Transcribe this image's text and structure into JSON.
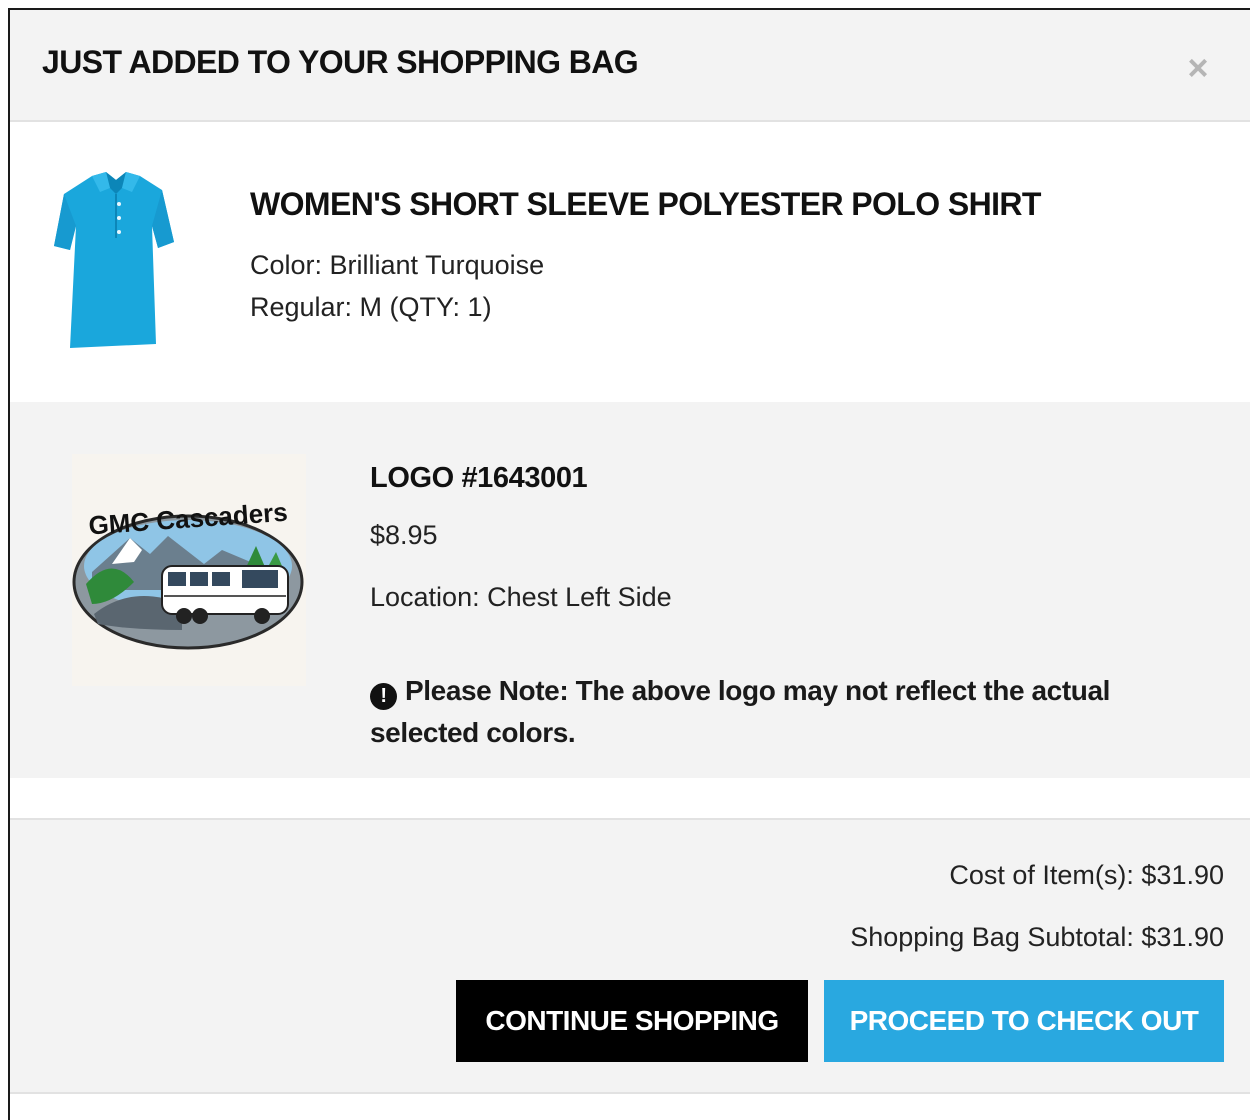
{
  "modal": {
    "title": "JUST ADDED TO YOUR SHOPPING BAG",
    "close_label": "×"
  },
  "product": {
    "image_icon": "polo-shirt-image",
    "image_color": "#1aa7dc",
    "name": "WOMEN'S SHORT SLEEVE POLYESTER POLO SHIRT",
    "color": "Color: Brilliant Turquoise",
    "size_qty": "Regular: M (QTY: 1)"
  },
  "logo": {
    "image_text": "GMC Cascaders",
    "title": "LOGO #1643001",
    "price": "$8.95",
    "location": "Location: Chest Left Side",
    "note_icon": "exclamation-circle-icon",
    "note_text": "Please Note: The above logo may not reflect the actual selected colors."
  },
  "summary": {
    "cost": "Cost of Item(s): $31.90",
    "subtotal": "Shopping Bag Subtotal: $31.90"
  },
  "buttons": {
    "continue": "CONTINUE SHOPPING",
    "checkout": "PROCEED TO CHECK OUT"
  },
  "colors": {
    "accent": "#29a8e0",
    "button_dark": "#000000",
    "panel_bg": "#f3f3f3"
  }
}
